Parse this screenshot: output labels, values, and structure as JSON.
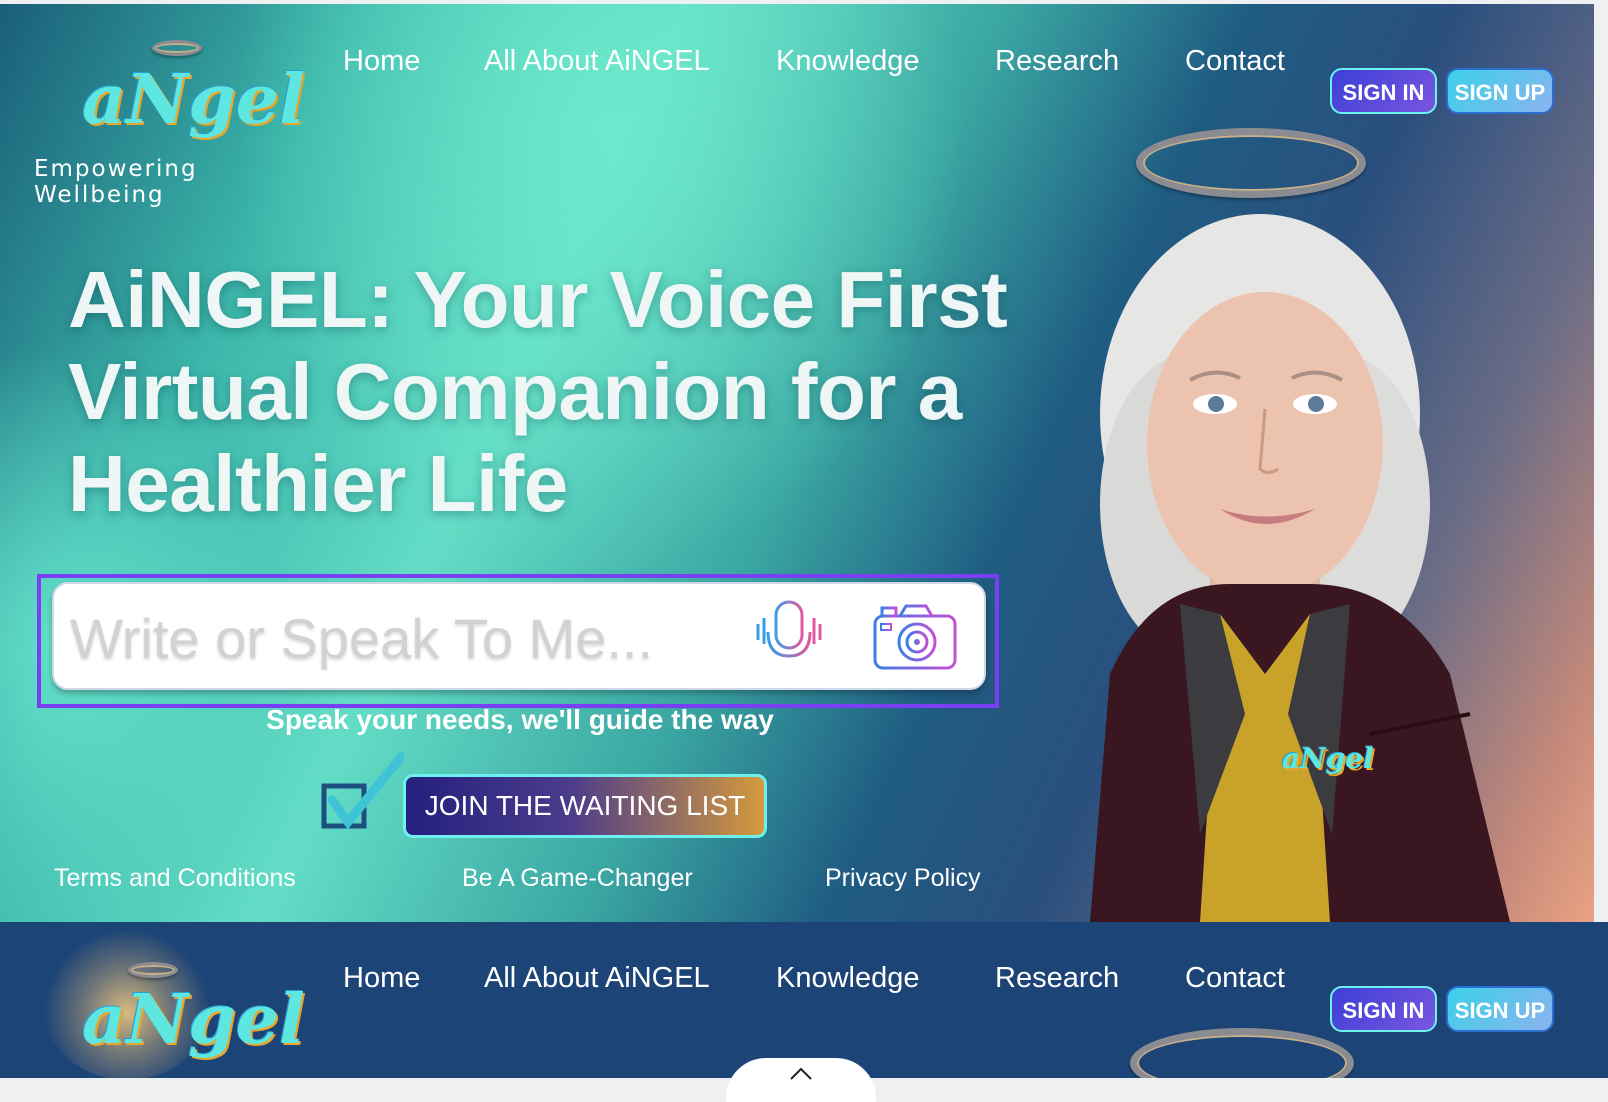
{
  "header": {
    "logo_text": "aNgel",
    "logo_tagline": "Empowering Wellbeing",
    "nav": [
      "Home",
      "All About AiNGEL",
      "Knowledge",
      "Research",
      "Contact"
    ],
    "sign_in": "SIGN IN",
    "sign_up": "SIGN UP"
  },
  "hero": {
    "headline": "AiNGEL: Your Voice First Virtual Companion for a Healthier Life",
    "search_placeholder": "Write or Speak To Me...",
    "tagline": "Speak your needs, we'll guide the way",
    "join_label": "JOIN THE WAITING LIST",
    "jacket_logo": "aNgel"
  },
  "footer_links": [
    "Terms and Conditions",
    "Be A Game-Changer",
    "Privacy Policy"
  ],
  "footer_bar": {
    "logo_text": "aNgel",
    "nav": [
      "Home",
      "All About AiNGEL",
      "Knowledge",
      "Research",
      "Contact"
    ],
    "sign_in": "SIGN IN",
    "sign_up": "SIGN UP"
  },
  "colors": {
    "accent_purple": "#7a3ff2",
    "footer_bg": "#1d4476",
    "logo_cyan": "#5ee6e0"
  }
}
